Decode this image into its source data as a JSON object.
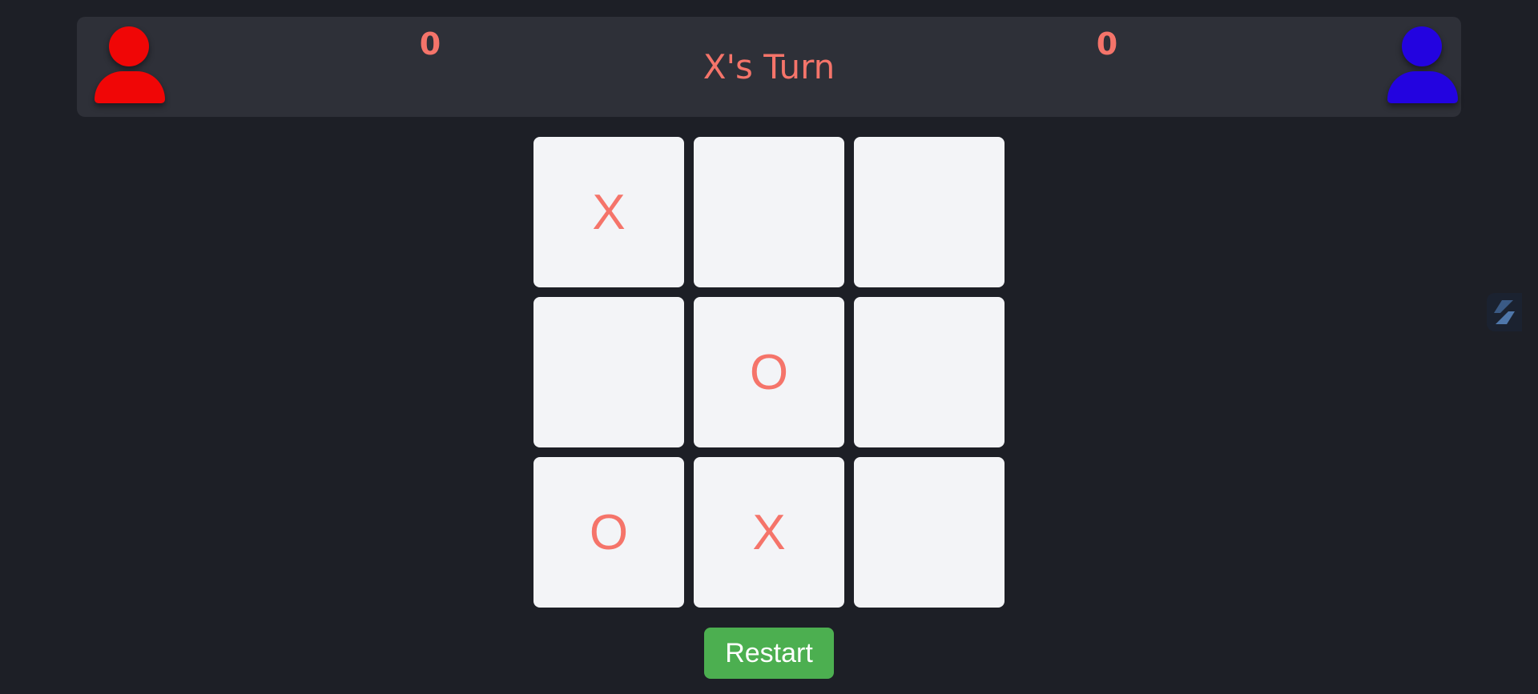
{
  "players": {
    "x": {
      "score": "0",
      "color": "#f00606"
    },
    "o": {
      "score": "0",
      "color": "#2303e0"
    }
  },
  "status": {
    "text": "X's Turn"
  },
  "board": {
    "cells": [
      "X",
      "",
      "",
      "",
      "O",
      "",
      "O",
      "X",
      ""
    ]
  },
  "controls": {
    "restart_label": "Restart"
  },
  "colors": {
    "mark": "#f5746a",
    "background": "#1d1f26",
    "panel": "#2e3038",
    "cell": "#f3f4f7",
    "restart": "#4caf50"
  },
  "icons": {
    "player_x": "person-icon",
    "player_o": "person-icon",
    "side_widget": "extension-icon"
  }
}
